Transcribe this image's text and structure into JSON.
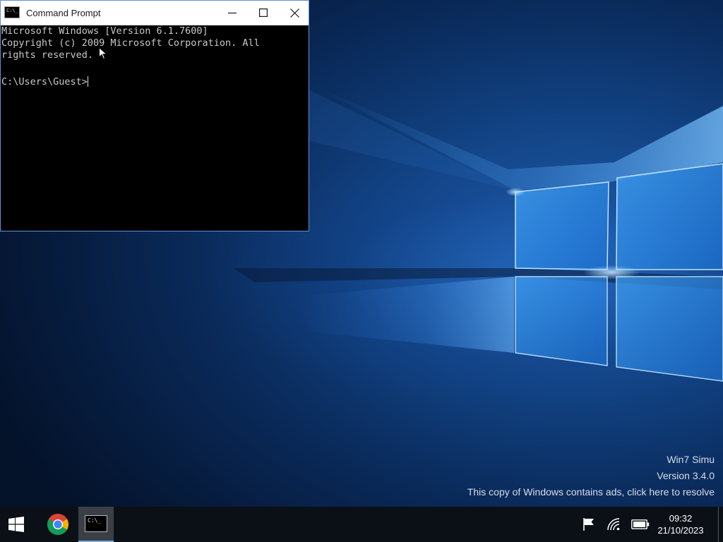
{
  "window": {
    "title": "Command Prompt",
    "icon": "cmd-icon",
    "controls": {
      "minimize_icon": "minimize-icon",
      "maximize_icon": "maximize-icon",
      "close_icon": "close-icon"
    },
    "console_lines": [
      "Microsoft Windows [Version 6.1.7600]",
      "Copyright (c) 2009 Microsoft Corporation. All",
      "rights reserved.",
      "",
      "C:\\Users\\Guest>"
    ],
    "colors": {
      "background": "#000000",
      "text": "#c8c8c8",
      "border": "#5f8fd4"
    }
  },
  "watermark": {
    "line1": "Win7 Simu",
    "line2": "Version 3.4.0",
    "line3": "This copy of Windows contains ads, click here to resolve"
  },
  "taskbar": {
    "start_icon": "windows-logo-icon",
    "apps": [
      {
        "name": "Chrome",
        "icon": "chrome-icon",
        "active": false
      },
      {
        "name": "Command Prompt",
        "icon": "cmd-icon",
        "active": true
      }
    ],
    "tray": {
      "icons": [
        "flag-icon",
        "wifi-icon",
        "battery-icon"
      ],
      "time": "09:32",
      "date": "21/10/2023"
    },
    "colors": {
      "background": "#0b0f16",
      "active_app_bg": "#3a3e45",
      "active_indicator": "#76a9e4"
    }
  },
  "desktop": {
    "wallpaper": "windows-10-light-beams",
    "accent": "#1f5fae"
  }
}
